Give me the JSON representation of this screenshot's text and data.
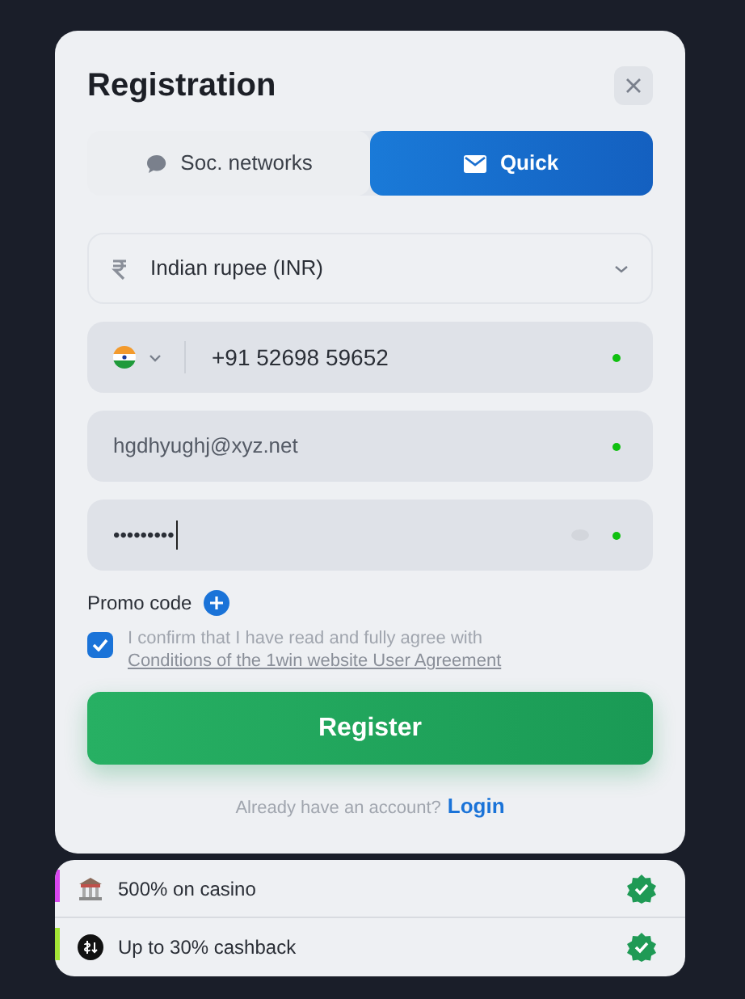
{
  "dialog": {
    "title": "Registration"
  },
  "tabs": [
    {
      "label": "Soc. networks",
      "selected": false,
      "kind": "social"
    },
    {
      "label": "Quick",
      "selected": true,
      "kind": "mail"
    }
  ],
  "currency": {
    "value": "Indian rupee (INR)"
  },
  "fields": [
    {
      "kind": "phone",
      "value": "+91 52698 59652",
      "valid": true
    },
    {
      "kind": "email",
      "value": "hgdhyughj@xyz.net",
      "valid": true
    },
    {
      "kind": "password",
      "value": "•••••••••",
      "valid": true
    }
  ],
  "promo": {
    "label": "Promo code"
  },
  "agreement": {
    "checked": true,
    "text": "I confirm that I have read and fully agree with",
    "link": "Conditions of the 1win website User Agreement"
  },
  "register_button": "Register",
  "login_prompt": {
    "text": "Already have an account?",
    "link": "Login"
  },
  "bonuses": [
    {
      "kind": "casino",
      "label": "500% on casino",
      "color": "#d946ef"
    },
    {
      "kind": "cashback",
      "label": "Up to 30% cashback",
      "color": "#a3e635"
    }
  ]
}
